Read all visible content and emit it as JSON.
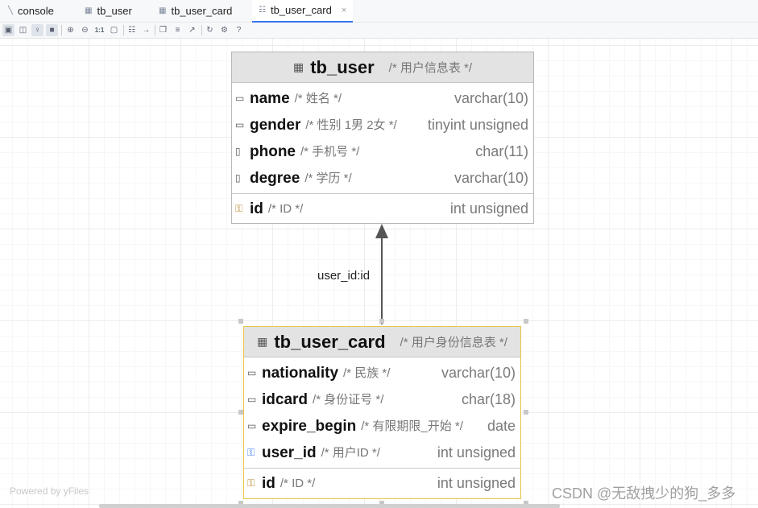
{
  "tabs": [
    {
      "label": "console",
      "icon": "console-icon",
      "active": false
    },
    {
      "label": "tb_user",
      "icon": "table-icon",
      "active": false
    },
    {
      "label": "tb_user_card",
      "icon": "table-icon",
      "active": false
    },
    {
      "label": "tb_user_card",
      "icon": "diagram-icon",
      "active": true,
      "close": "×"
    }
  ],
  "toolbar": {
    "zoom_actual_label": "1:1",
    "help_label": "?"
  },
  "entities": {
    "tb_user": {
      "name": "tb_user",
      "comment": "/* 用户信息表 */",
      "columns": [
        {
          "name": "name",
          "comment": "/* 姓名 */",
          "type": "varchar(10)"
        },
        {
          "name": "gender",
          "comment": "/* 性别 1男 2女 */",
          "type": "tinyint unsigned"
        },
        {
          "name": "phone",
          "comment": "/* 手机号 */",
          "type": "char(11)"
        },
        {
          "name": "degree",
          "comment": "/* 学历 */",
          "type": "varchar(10)"
        }
      ],
      "key": {
        "name": "id",
        "comment": "/* ID */",
        "type": "int unsigned"
      }
    },
    "tb_user_card": {
      "name": "tb_user_card",
      "comment": "/* 用户身份信息表 */",
      "columns": [
        {
          "name": "nationality",
          "comment": "/* 民族 */",
          "type": "varchar(10)"
        },
        {
          "name": "idcard",
          "comment": "/* 身份证号 */",
          "type": "char(18)"
        },
        {
          "name": "expire_begin",
          "comment": "/* 有限期限_开始 */",
          "type": "date"
        },
        {
          "name": "user_id",
          "comment": "/* 用户ID */",
          "type": "int unsigned"
        }
      ],
      "key": {
        "name": "id",
        "comment": "/* ID */",
        "type": "int unsigned"
      }
    }
  },
  "relation": {
    "label": "user_id:id"
  },
  "watermark": "Powered by yFiles",
  "credit": "CSDN @无敌拽少的狗_多多"
}
